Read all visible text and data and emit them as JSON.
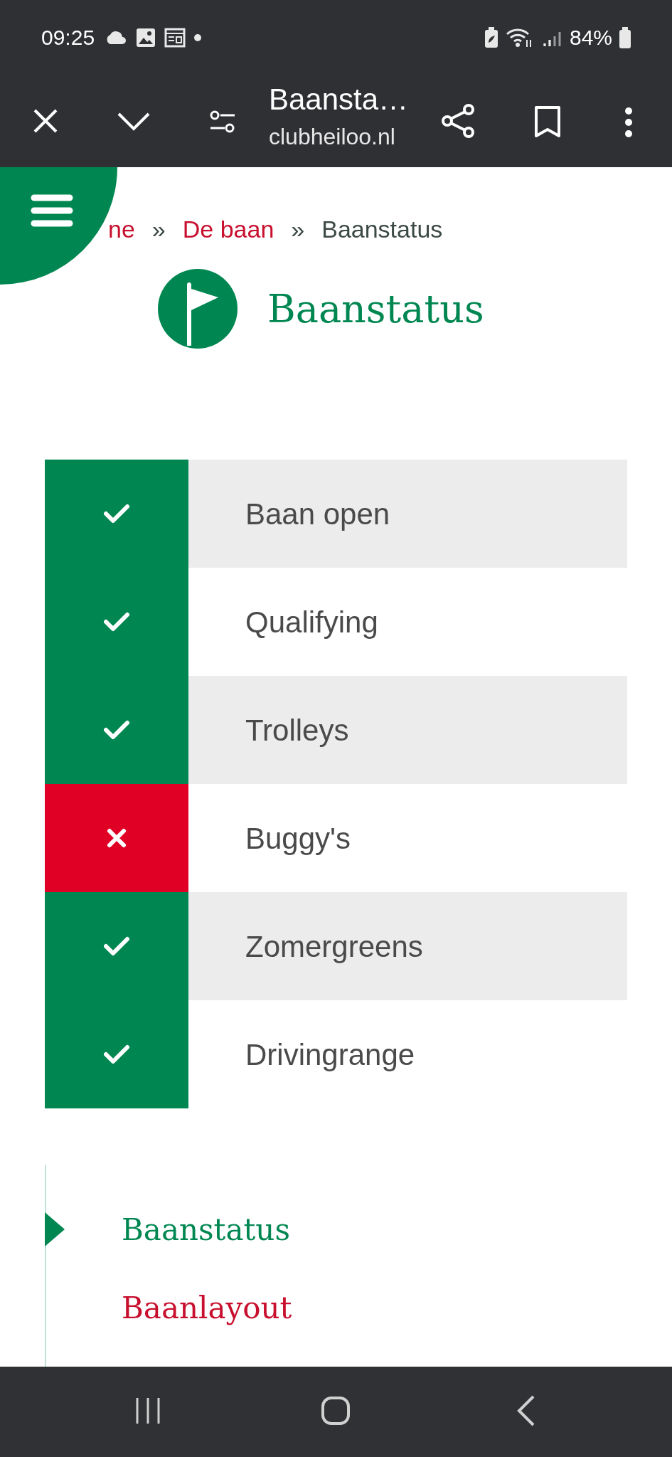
{
  "status_bar": {
    "time": "09:25",
    "battery": "84%"
  },
  "browser": {
    "title": "Baansta…",
    "url": "clubheiloo.nl"
  },
  "breadcrumb": [
    {
      "text": "ne",
      "kind": "link"
    },
    {
      "text": "»",
      "kind": "separator"
    },
    {
      "text": "De baan",
      "kind": "link"
    },
    {
      "text": "»",
      "kind": "separator"
    },
    {
      "text": "Baanstatus",
      "kind": "current"
    }
  ],
  "title": "Baanstatus",
  "statuses": [
    {
      "label": "Baan open",
      "open": true
    },
    {
      "label": "Qualifying",
      "open": true
    },
    {
      "label": "Trolleys",
      "open": true
    },
    {
      "label": "Buggy's",
      "open": false
    },
    {
      "label": "Zomergreens",
      "open": true
    },
    {
      "label": "Drivingrange",
      "open": true
    }
  ],
  "side_nav": [
    {
      "label": "Baanstatus",
      "selected": true
    },
    {
      "label": "Baanlayout",
      "selected": false
    }
  ]
}
